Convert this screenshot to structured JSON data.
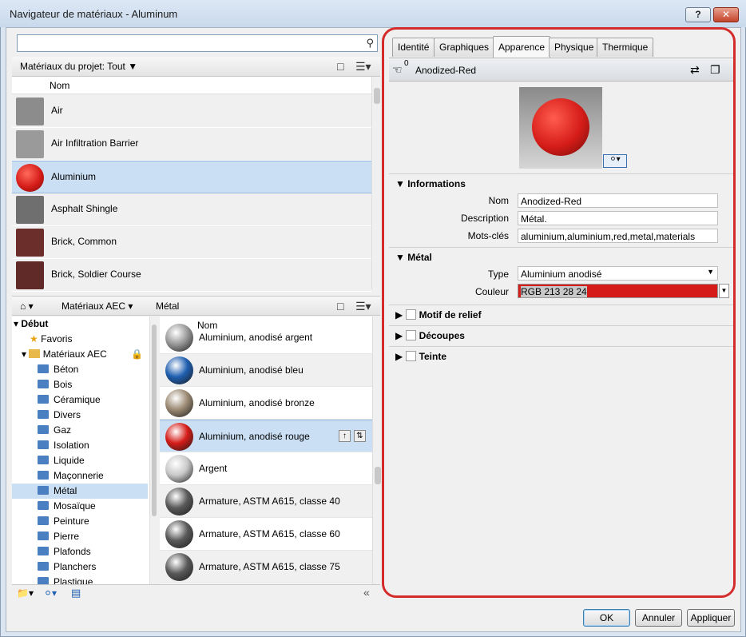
{
  "window": {
    "title": "Navigateur de matériaux - Aluminum",
    "help_label": "?",
    "close_label": "✕"
  },
  "search": {
    "placeholder": "",
    "icon": "search-icon"
  },
  "project_bar": {
    "crumb": "Matériaux du projet: Tout"
  },
  "project_list": {
    "column_header": "Nom",
    "rows": [
      {
        "name": "Air",
        "color": "#8c8c8c"
      },
      {
        "name": "Air Infiltration Barrier",
        "color": "#9a9a9a"
      },
      {
        "name": "Aluminium",
        "color": "#d51c18",
        "selected": true
      },
      {
        "name": "Asphalt Shingle",
        "color": "#6f6f6f"
      },
      {
        "name": "Brick, Common",
        "color": "#6b2e2a"
      },
      {
        "name": "Brick, Soldier Course",
        "color": "#5f2a27"
      }
    ]
  },
  "library_bar": {
    "crumb1": "Matériaux AEC",
    "crumb2": "Métal"
  },
  "tree": {
    "root": "Début",
    "favorites": "Favoris",
    "library": "Matériaux AEC",
    "items": [
      "Béton",
      "Bois",
      "Céramique",
      "Divers",
      "Gaz",
      "Isolation",
      "Liquide",
      "Maçonnerie",
      "Métal",
      "Mosaïque",
      "Peinture",
      "Pierre",
      "Plafonds",
      "Planchers",
      "Plastique"
    ],
    "selected_index": 8
  },
  "library_list": {
    "column_header": "Nom",
    "rows": [
      {
        "name": "Aluminium, anodisé argent",
        "color": "#9a9a9a"
      },
      {
        "name": "Aluminium, anodisé bleu",
        "color": "#1f5fb0"
      },
      {
        "name": "Aluminium, anodisé bronze",
        "color": "#9c8a74"
      },
      {
        "name": "Aluminium, anodisé rouge",
        "color": "#d51c18",
        "selected": true
      },
      {
        "name": "Argent",
        "color": "#c9c9c9"
      },
      {
        "name": "Armature, ASTM A615, classe 40",
        "color": "#5a5a5a"
      },
      {
        "name": "Armature, ASTM A615, classe 60",
        "color": "#5a5a5a"
      },
      {
        "name": "Armature, ASTM A615, classe 75",
        "color": "#5a5a5a"
      }
    ]
  },
  "tabs": [
    "Identité",
    "Graphiques",
    "Apparence",
    "Physique",
    "Thermique"
  ],
  "active_tab": 2,
  "asset": {
    "count": "0",
    "name": "Anodized-Red"
  },
  "preview": {
    "color": "#d51c18"
  },
  "information": {
    "header": "Informations",
    "name_label": "Nom",
    "name_value": "Anodized-Red",
    "desc_label": "Description",
    "desc_value": "Métal.",
    "keywords_label": "Mots-clés",
    "keywords_value": "aluminium,aluminium,red,metal,materials"
  },
  "metal": {
    "header": "Métal",
    "type_label": "Type",
    "type_value": "Aluminium anodisé",
    "color_label": "Couleur",
    "color_value": "RGB 213 28 24",
    "swatch": "#d51c18"
  },
  "sections": [
    "Motif de relief",
    "Découpes",
    "Teinte"
  ],
  "buttons": {
    "ok": "OK",
    "cancel": "Annuler",
    "apply": "Appliquer"
  },
  "accent": "#d42b2b"
}
